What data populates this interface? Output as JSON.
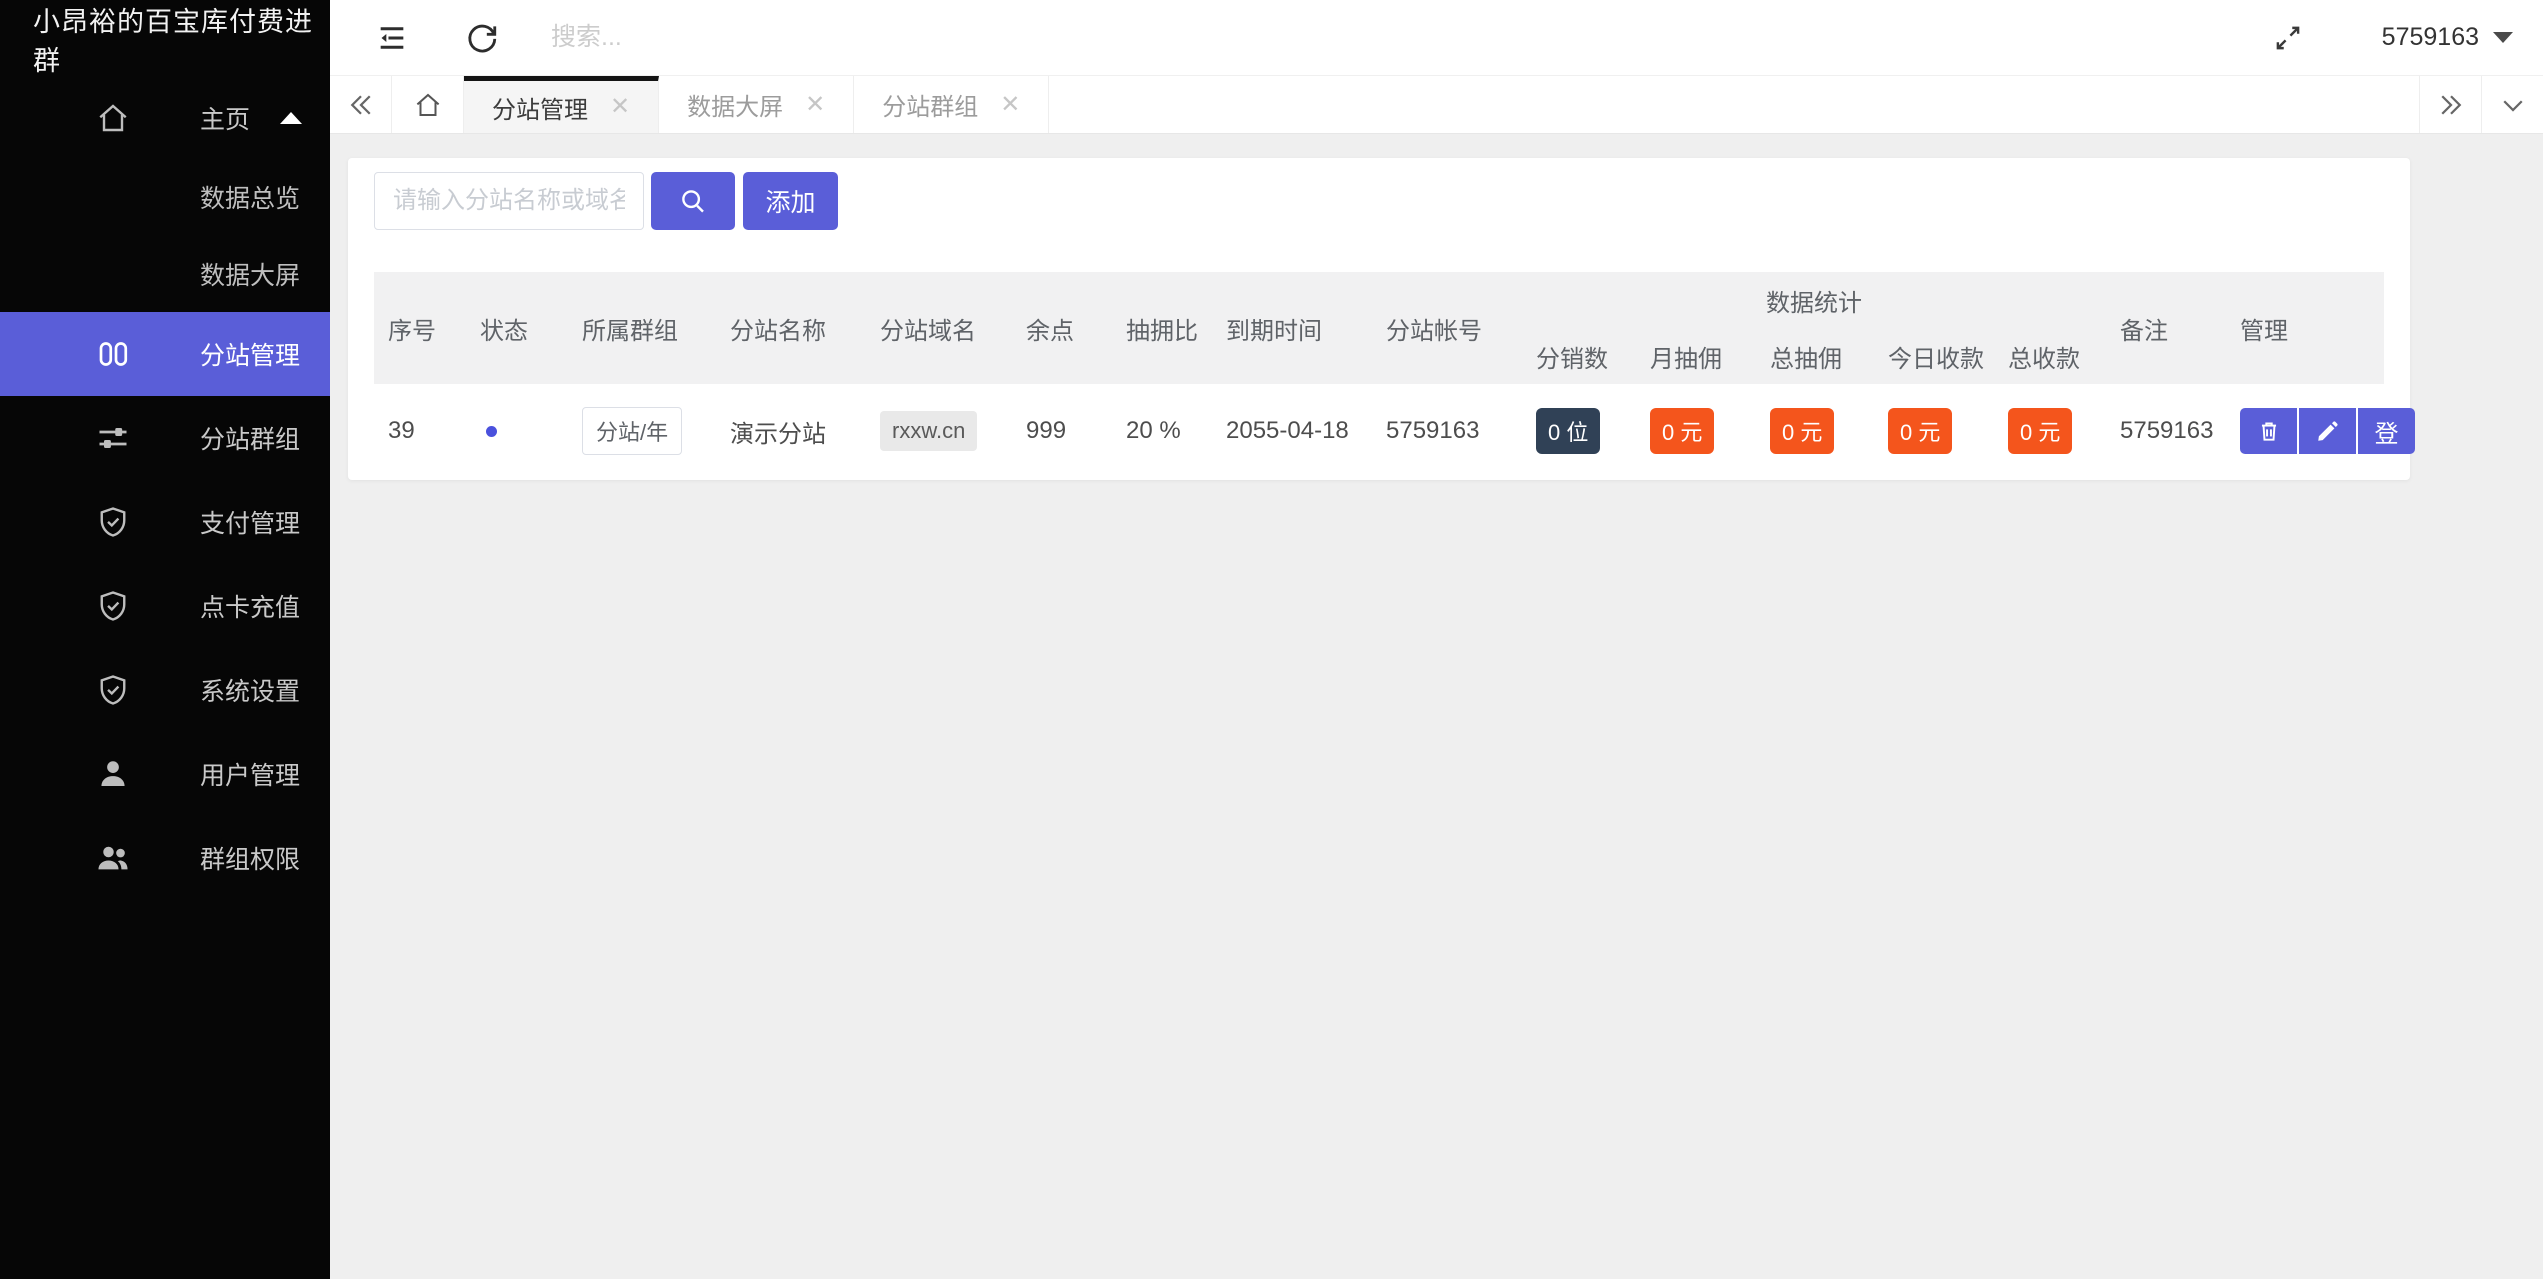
{
  "sidebar": {
    "title": "小昂裕的百宝库付费进群",
    "items": [
      {
        "label": "主页"
      },
      {
        "label": "数据总览"
      },
      {
        "label": "数据大屏"
      },
      {
        "label": "分站管理"
      },
      {
        "label": "分站群组"
      },
      {
        "label": "支付管理"
      },
      {
        "label": "点卡充值"
      },
      {
        "label": "系统设置"
      },
      {
        "label": "用户管理"
      },
      {
        "label": "群组权限"
      }
    ]
  },
  "topbar": {
    "search_placeholder": "搜索...",
    "username": "5759163"
  },
  "tabbar": {
    "tabs": [
      {
        "label": "分站管理",
        "close": "✕"
      },
      {
        "label": "数据大屏",
        "close": "✕"
      },
      {
        "label": "分站群组",
        "close": "✕"
      }
    ]
  },
  "toolbar": {
    "search_placeholder": "请输入分站名称或域名",
    "add_button": "添加"
  },
  "table": {
    "headers": {
      "index": "序号",
      "status": "状态",
      "group": "所属群组",
      "site_name": "分站名称",
      "domain": "分站域名",
      "points": "余点",
      "ratio": "抽拥比",
      "expire": "到期时间",
      "account": "分站帐号",
      "stats_group": "数据统计",
      "distributors": "分销数",
      "month_commission": "月抽佣",
      "total_commission": "总抽佣",
      "today_income": "今日收款",
      "total_income": "总收款",
      "remark": "备注",
      "manage": "管理"
    },
    "rows": [
      {
        "index": "39",
        "group_tag": "分站/年",
        "site_name": "演示分站",
        "domain": "rxxw.cn",
        "points": "999",
        "ratio": "20 %",
        "expire": "2055-04-18",
        "account": "5759163",
        "distributors": "0 位",
        "month_commission": "0 元",
        "total_commission": "0 元",
        "today_income": "0 元",
        "total_income": "0 元",
        "remark": "5759163",
        "login_button": "登"
      }
    ]
  },
  "colors": {
    "accent": "#5a5ed8",
    "badge_dark": "#304156",
    "badge_orange": "#f4551c",
    "status_dot": "#4a51dd",
    "sidebar_bg": "#060606",
    "page_bg": "#efefef"
  }
}
